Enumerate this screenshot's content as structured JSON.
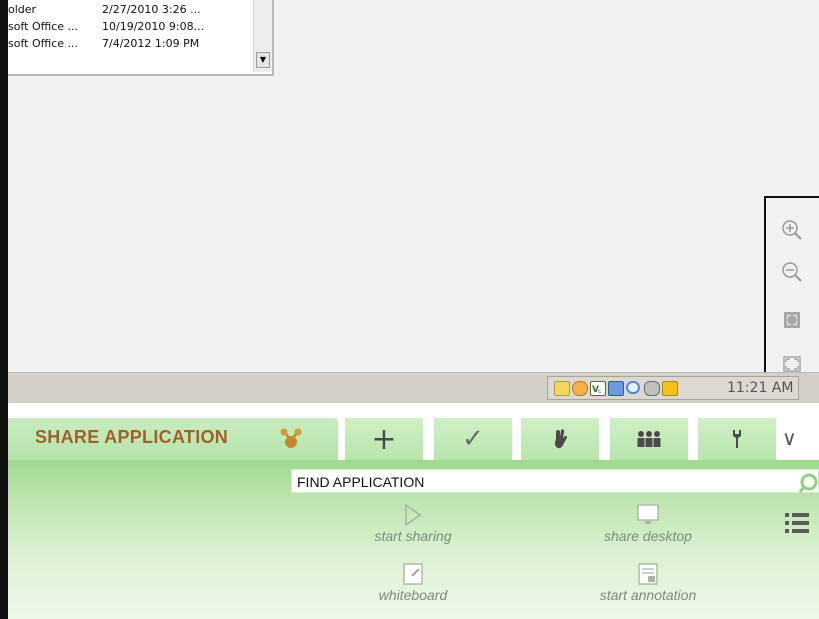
{
  "file_list": {
    "rows": [
      {
        "name": "older",
        "date": "2/27/2010 3:26 ..."
      },
      {
        "name": "soft Office ...",
        "date": "10/19/2010 9:08..."
      },
      {
        "name": "soft Office ...",
        "date": "7/4/2012 1:09 PM"
      }
    ],
    "scroll_down_glyph": "▼"
  },
  "zoom_panel": {
    "icons": [
      "zoom-in-icon",
      "zoom-out-icon",
      "fit-icon",
      "fullscreen-icon"
    ]
  },
  "taskbar": {
    "clock": "11:21 AM",
    "tray_icons": [
      "mail-icon",
      "clock-icon",
      "vc-icon",
      "network-icon",
      "cycle-icon",
      "speaker-icon",
      "shield-icon"
    ]
  },
  "toolbar": {
    "active_tab_label": "SHARE APPLICATION",
    "tabs": [
      {
        "name": "add",
        "glyph": "+"
      },
      {
        "name": "check",
        "glyph": "✓"
      },
      {
        "name": "raise-hand",
        "glyph": "✋"
      },
      {
        "name": "participants",
        "glyph": "👥"
      },
      {
        "name": "tools",
        "glyph": "🔧"
      }
    ],
    "chevron_glyph": "∨"
  },
  "panel": {
    "find_label": "FIND APPLICATION",
    "actions": [
      {
        "label": "start sharing",
        "icon": "play-icon"
      },
      {
        "label": "share desktop",
        "icon": "monitor-icon"
      },
      {
        "label": "whiteboard",
        "icon": "whiteboard-icon"
      },
      {
        "label": "start annotation",
        "icon": "annotation-icon"
      }
    ]
  },
  "colors": {
    "tab_label": "#a0622a",
    "panel_green": "#9fd98f",
    "action_label": "#7d8b7a"
  }
}
